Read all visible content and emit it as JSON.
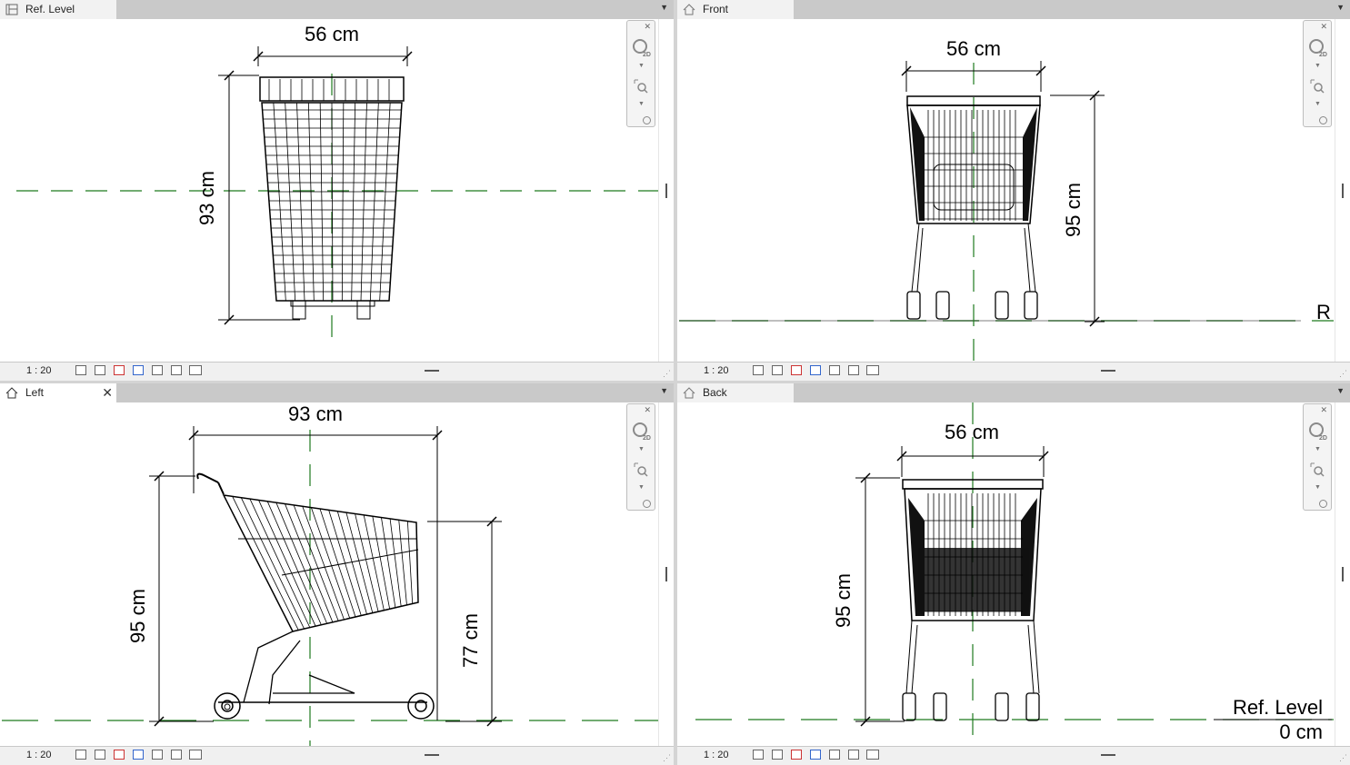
{
  "views": {
    "ref_level": {
      "tab": "Ref. Level",
      "scale": "1 : 20",
      "dim_top": "56 cm",
      "dim_side": "93 cm"
    },
    "front": {
      "tab": "Front",
      "scale": "1 : 20",
      "dim_top": "56 cm",
      "dim_side": "95 cm",
      "level_label_partial": "R"
    },
    "left": {
      "tab": "Left",
      "close": "✕",
      "scale": "1 : 20",
      "dim_top": "93 cm",
      "dim_side": "95 cm",
      "dim_basket": "77 cm"
    },
    "back": {
      "tab": "Back",
      "scale": "1 : 20",
      "dim_top": "56 cm",
      "dim_side": "95 cm",
      "level_name": "Ref. Level",
      "level_value": "0 cm"
    }
  },
  "icons": {
    "plan": "plan-view-icon",
    "elevation": "elevation-view-icon",
    "menu": "tab-menu-icon",
    "wheel": "steering-wheel-icon",
    "zoom": "zoom-icon"
  },
  "colors": {
    "grid_line": "#1e7a1e",
    "tab_bar": "#c9c9c9",
    "status_bar": "#f0f0f0"
  }
}
